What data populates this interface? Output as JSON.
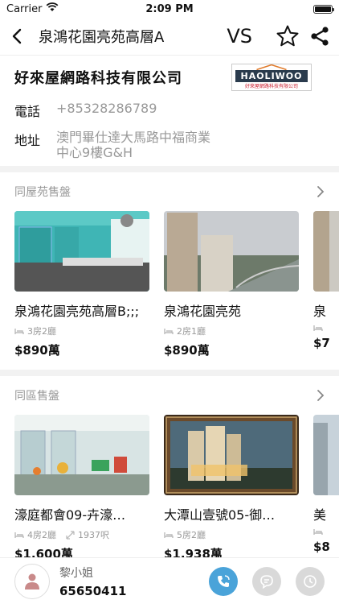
{
  "status_bar": {
    "carrier": "Carrier",
    "time": "2:09 PM"
  },
  "nav": {
    "title": "泉鴻花園亮苑高層A",
    "vs_label": "VS"
  },
  "agency": {
    "name": "好來屋網路科技有限公司",
    "logo_text": "HAOLIWOO",
    "logo_subtext": "好來屋網路科技有限公司",
    "phone_label": "電話",
    "phone_value": "+85328286789",
    "address_label": "地址",
    "address_line1": "澳門畢仕達大馬路中福商業",
    "address_line2": "中心9樓G&H"
  },
  "same_estate": {
    "title": "同屋苑售盤",
    "cards": [
      {
        "title": "泉鴻花園亮苑高層B;;;",
        "rooms": "3房2廳",
        "area": "",
        "price": "$890萬"
      },
      {
        "title": "泉鴻花園亮苑",
        "rooms": "2房1廳",
        "area": "",
        "price": "$890萬"
      },
      {
        "title": "泉",
        "rooms": "",
        "area": "",
        "price": "$7"
      }
    ]
  },
  "same_district": {
    "title": "同區售盤",
    "cards": [
      {
        "title": "濠庭都會09-卉濠…",
        "rooms": "4房2廳",
        "area": "1937呎",
        "price": "$1,600萬"
      },
      {
        "title": "大潭山壹號05-御…",
        "rooms": "5房2廳",
        "area": "",
        "price": "$1,938萬"
      },
      {
        "title": "美",
        "rooms": "",
        "area": "",
        "price": "$8"
      }
    ]
  },
  "contact": {
    "name": "黎小姐",
    "phone": "65650411"
  },
  "colors": {
    "accent": "#4aa3d9",
    "muted_button": "#d9d9d9",
    "text_muted": "#999999"
  }
}
